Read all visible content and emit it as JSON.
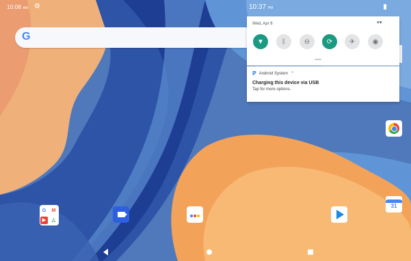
{
  "status_bar": {
    "time_left": "10:08",
    "time_left_suffix": "AM",
    "time_right": "10:37",
    "time_right_suffix": "PM"
  },
  "quick_settings": {
    "date": "Wed, Apr 8",
    "tiles": [
      {
        "icon": "wifi-icon",
        "state": "on"
      },
      {
        "icon": "bluetooth-icon",
        "state": "off"
      },
      {
        "icon": "do-not-disturb-icon",
        "state": "off"
      },
      {
        "icon": "auto-rotate-icon",
        "state": "on"
      },
      {
        "icon": "airplane-mode-icon",
        "state": "off"
      },
      {
        "icon": "eye-icon",
        "state": "off"
      }
    ]
  },
  "notification": {
    "app_name": "Android System",
    "title": "Charging this device via USB",
    "text": "Tap for more options."
  },
  "search": {
    "logo": "G"
  },
  "apps": {
    "calendar_day": "31",
    "folder_items": [
      "G",
      "M",
      "▶",
      "△"
    ]
  },
  "colors": {
    "accent_teal": "#1a9a82",
    "wallpaper_blue": "#4d77b8",
    "wallpaper_orange": "#f5a35d"
  }
}
